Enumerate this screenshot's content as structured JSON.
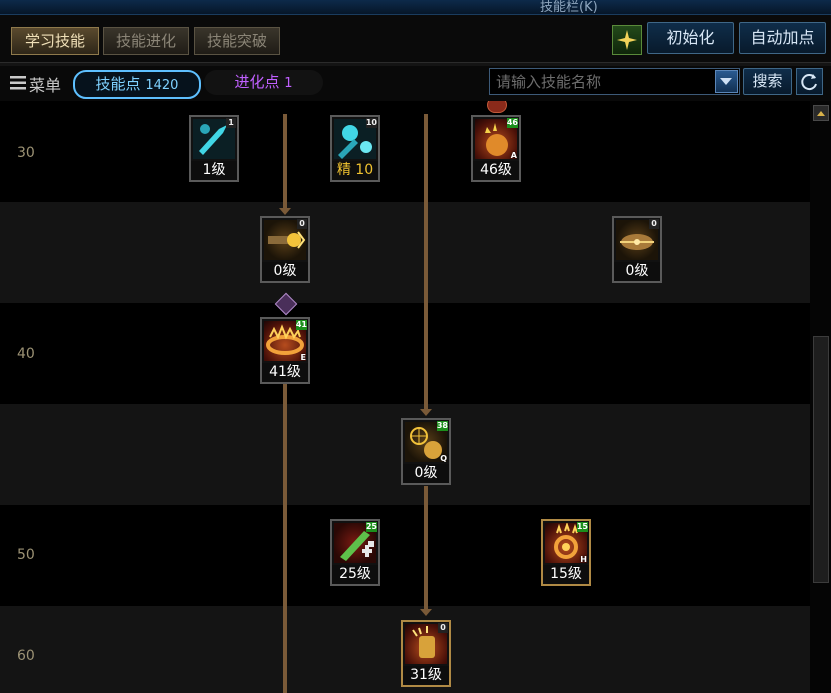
{
  "window": {
    "title": "技能栏(K)"
  },
  "tabs": [
    {
      "label": "学习技能",
      "active": true
    },
    {
      "label": "技能进化",
      "active": false
    },
    {
      "label": "技能突破",
      "active": false
    }
  ],
  "header_buttons": {
    "init": "初始化",
    "auto_add": "自动加点"
  },
  "menu": {
    "label": "菜单"
  },
  "skill_points": {
    "label": "技能点",
    "value": "1420"
  },
  "evolution_points": {
    "label": "进化点",
    "value": "1"
  },
  "search": {
    "placeholder": "请输入技能名称",
    "button": "搜索"
  },
  "levels": [
    "30",
    "40",
    "50",
    "60"
  ],
  "skills": [
    {
      "id": "s1",
      "icon": "cyan-sword-icon",
      "badge": "1",
      "label": "1级"
    },
    {
      "id": "s2",
      "icon": "cyan-burst-icon",
      "badge": "10",
      "label": "精 10"
    },
    {
      "id": "s3",
      "icon": "fire-bomb-icon",
      "badge": "46",
      "key": "A",
      "label": "46级"
    },
    {
      "id": "s4",
      "icon": "spark-cannon-icon",
      "badge": "0",
      "label": "0级"
    },
    {
      "id": "s5",
      "icon": "sawblade-icon",
      "badge": "0",
      "label": "0级"
    },
    {
      "id": "s6",
      "icon": "flame-ring-icon",
      "badge": "41",
      "key": "E",
      "label": "41级"
    },
    {
      "id": "s7",
      "icon": "target-bomb-icon",
      "badge": "38",
      "key": "Q",
      "label": "0级"
    },
    {
      "id": "s8",
      "icon": "green-spanner-icon",
      "badge": "25",
      "label": "25级"
    },
    {
      "id": "s9",
      "icon": "fire-eye-icon",
      "badge": "15",
      "key": "H",
      "label": "15级"
    },
    {
      "id": "s10",
      "icon": "fire-gauntlet-icon",
      "badge": "0",
      "label": "31级"
    }
  ],
  "colors": {
    "accent_blue": "#3f6787",
    "skill_pill": "#5ec0ff",
    "evo_pill": "#c060ff",
    "connector": "#7a5a38",
    "level_text": "#9c9274"
  }
}
